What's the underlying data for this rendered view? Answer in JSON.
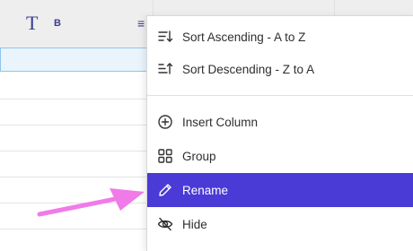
{
  "grid": {
    "column_header": {
      "type_icon": "T",
      "name": "B",
      "menu_icon": "≡"
    }
  },
  "menu": {
    "items": [
      {
        "label": "Sort Ascending - A to Z",
        "icon": "sort-ascending-icon"
      },
      {
        "label": "Sort Descending - Z to A",
        "icon": "sort-descending-icon"
      },
      {
        "label": "Insert Column",
        "icon": "plus-circle-icon"
      },
      {
        "label": "Group",
        "icon": "grid-icon"
      },
      {
        "label": "Rename",
        "icon": "pencil-icon",
        "active": true
      },
      {
        "label": "Hide",
        "icon": "eye-off-icon"
      }
    ]
  },
  "colors": {
    "active_bg": "#4a3ad6",
    "header_text": "#3a3d8f",
    "annotation_arrow": "#f07be8"
  }
}
